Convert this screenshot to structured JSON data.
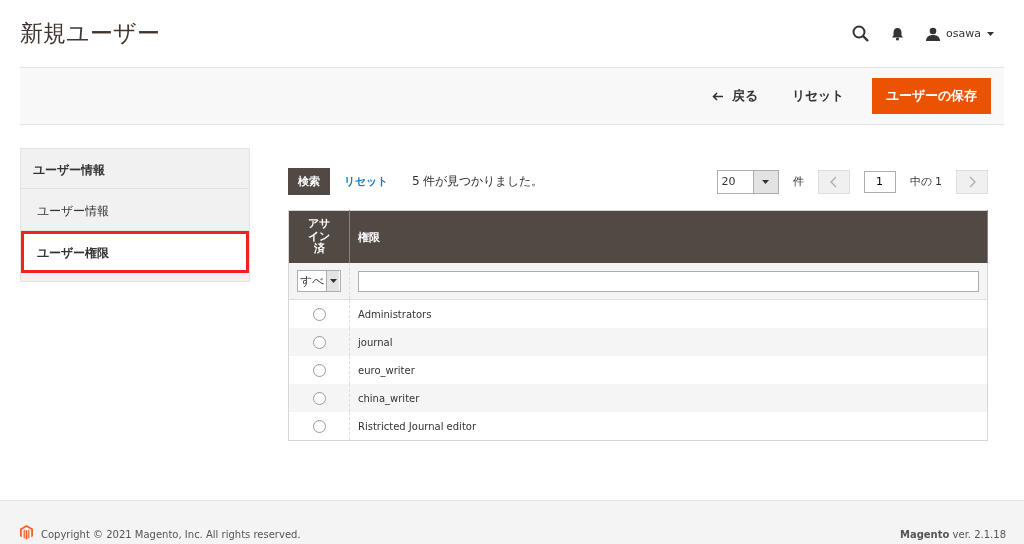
{
  "page_title": "新規ユーザー",
  "header": {
    "user": "osawa"
  },
  "actions": {
    "back": "戻る",
    "reset": "リセット",
    "save": "ユーザーの保存"
  },
  "sidebar": {
    "title": "ユーザー情報",
    "tabs": [
      {
        "label": "ユーザー情報",
        "selected": false,
        "highlighted": false
      },
      {
        "label": "ユーザー権限",
        "selected": true,
        "highlighted": true
      }
    ]
  },
  "grid": {
    "search": "検索",
    "reset": "リセット",
    "found": "5 件が見つかりました。",
    "per_page": "20",
    "per_page_unit": "件",
    "page": "1",
    "page_of": "中の 1",
    "columns": [
      "アサイン済",
      "権限"
    ],
    "filter_select": "すべ",
    "rows": [
      {
        "name": "Administrators",
        "selected": false
      },
      {
        "name": "journal",
        "selected": false
      },
      {
        "name": "euro_writer",
        "selected": false
      },
      {
        "name": "china_writer",
        "selected": false
      },
      {
        "name": "Ristricted Journal editor",
        "selected": false
      }
    ]
  },
  "footer": {
    "copyright": "Copyright © 2021 Magento, Inc. All rights reserved.",
    "version": "**Magento** ver. 2.1.18"
  }
}
